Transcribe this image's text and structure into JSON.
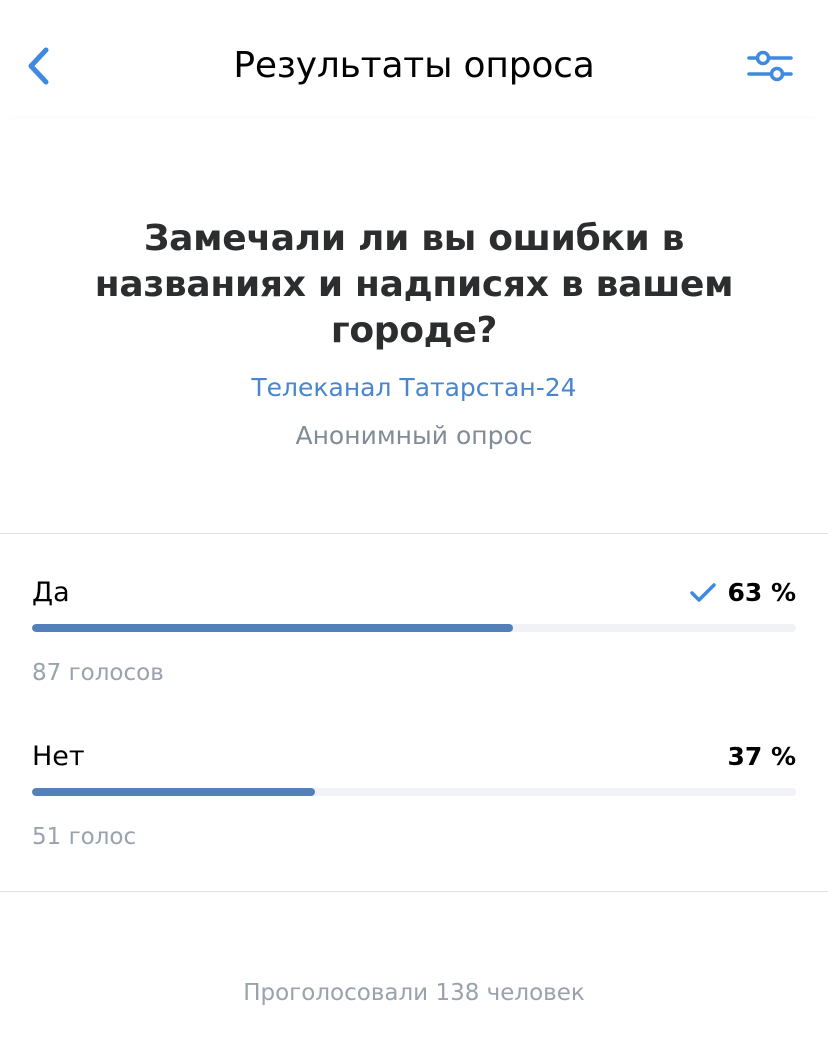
{
  "nav": {
    "title": "Результаты опроса",
    "back_icon": "chevron-left-icon",
    "filter_icon": "sliders-icon"
  },
  "poll": {
    "question": "Замечали ли вы ошибки в названиях и надписях в вашем городе?",
    "author": "Телеканал Татарстан-24",
    "type": "Анонимный опрос",
    "options": [
      {
        "label": "Да",
        "percent_text": "63 %",
        "fraction": 0.63,
        "votes_text": "87 голосов",
        "selected": true
      },
      {
        "label": "Нет",
        "percent_text": "37 %",
        "fraction": 0.37,
        "votes_text": "51 голос",
        "selected": false
      }
    ],
    "total_text": "Проголосовали 138 человек"
  },
  "colors": {
    "accent": "#4986cc",
    "bar_fill": "#5181b8",
    "bar_track": "#f0f2f5",
    "secondary_text": "#99a2ad"
  }
}
